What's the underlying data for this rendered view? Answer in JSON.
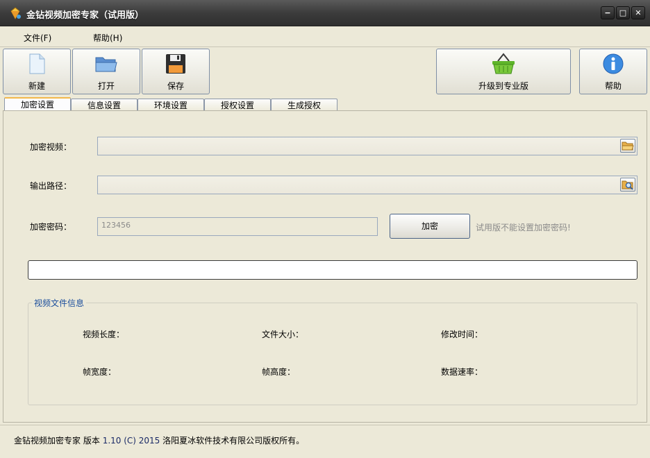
{
  "window": {
    "title": "金钻视频加密专家（试用版）",
    "controls": {
      "minimize": "−",
      "maximize": "□",
      "close": "✕"
    }
  },
  "menu": {
    "items": [
      {
        "label": "文件(F)"
      },
      {
        "label": "帮助(H)"
      }
    ]
  },
  "toolbar": {
    "new_label": "新建",
    "open_label": "打开",
    "save_label": "保存",
    "upgrade_label": "升级到专业版",
    "help_label": "帮助"
  },
  "tabs": [
    {
      "label": "加密设置",
      "active": true
    },
    {
      "label": "信息设置"
    },
    {
      "label": "环境设置"
    },
    {
      "label": "授权设置"
    },
    {
      "label": "生成授权"
    }
  ],
  "form": {
    "video_label": "加密视频：",
    "video_value": "",
    "output_label": "输出路径：",
    "output_value": "",
    "password_label": "加密密码：",
    "password_value": "123456",
    "encrypt_button": "加密",
    "trial_hint": "试用版不能设置加密密码!"
  },
  "progress": {
    "value": 0
  },
  "video_info": {
    "title": "视频文件信息",
    "length_label": "视频长度：",
    "size_label": "文件大小：",
    "modified_label": "修改时间：",
    "width_label": "帧宽度：",
    "height_label": "帧高度：",
    "rate_label": "数据速率："
  },
  "status": {
    "app_name": "金钻视频加密专家",
    "version_prefix": "版本",
    "version": "1.10 (C) 2015",
    "copyright": "洛阳夏冰软件技术有限公司版权所有。"
  },
  "colors": {
    "background": "#ece9d8",
    "titlebar": "#3c3c3c",
    "tab_highlight": "#f2b84a",
    "group_title": "#1a4d9c"
  },
  "icons": {
    "app": "diamond-app-icon",
    "new": "new-document-icon",
    "open": "folder-open-icon",
    "save": "floppy-disk-icon",
    "upgrade": "shopping-basket-icon",
    "help": "info-icon",
    "browse_video": "open-folder-icon",
    "browse_output": "folder-search-icon"
  }
}
